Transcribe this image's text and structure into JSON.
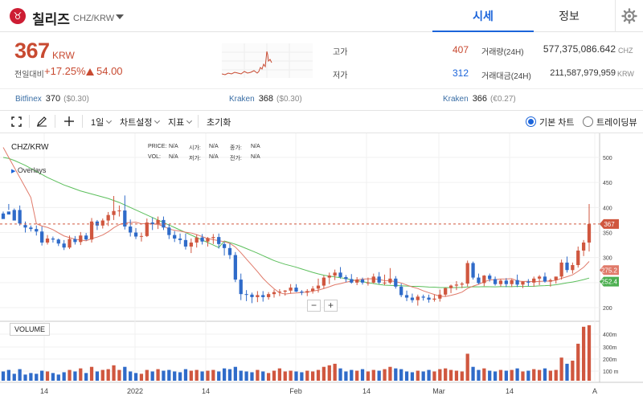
{
  "coin": {
    "logo_glyph": "♉",
    "name": "칠리즈",
    "pair": "CHZ/KRW"
  },
  "tabs": [
    {
      "label": "시세",
      "active": true
    },
    {
      "label": "정보",
      "active": false
    }
  ],
  "price": {
    "value": "367",
    "unit": "KRW",
    "change_label": "전일대비",
    "change_pct": "+17.25%",
    "change_amt": "54.00"
  },
  "stats": {
    "high_label": "고가",
    "high": "407",
    "low_label": "저가",
    "low": "312",
    "volume_label": "거래량(24H)",
    "volume": "577,375,086.642",
    "volume_unit": "CHZ",
    "value_label": "거래대금(24H)",
    "value": "211,587,979,959",
    "value_unit": "KRW"
  },
  "exchanges": [
    {
      "name": "Bitfinex",
      "price": "370",
      "change": "($0.30)"
    },
    {
      "name": "Kraken",
      "price": "368",
      "change": "($0.30)"
    },
    {
      "name": "Kraken",
      "price": "366",
      "change": "(€0.27)"
    }
  ],
  "toolbar": {
    "interval": "1일",
    "chart_settings": "차트설정",
    "indicators": "지표",
    "reset": "초기화",
    "basic_chart": "기본 차트",
    "trading_view": "트레이딩뷰"
  },
  "chart": {
    "symbol": "CHZ/KRW",
    "overlays": "Overlays",
    "volume_label": "VOLUME",
    "legend": {
      "price": "PRICE:",
      "open": "시가:",
      "high": "고가:",
      "close": "종가:",
      "vol": "VOL:",
      "low": "저가:",
      "prev": "전가:",
      "na": "N/A"
    },
    "zoom_out": "−",
    "zoom_in": "+",
    "badge_price": "367",
    "badge_ma1": "275.2",
    "badge_ma2": "252.4"
  },
  "colors": {
    "up": "#d0573f",
    "down": "#2f6bc9",
    "ma_short": "#e07a6a",
    "ma_long": "#5cbf5c",
    "accent": "#1b64da"
  },
  "chart_data": {
    "type": "candlestick",
    "y_ticks": [
      200,
      250,
      300,
      350,
      400,
      450,
      500
    ],
    "ylim": [
      180,
      520
    ],
    "vol_ticks": [
      "100 m",
      "200m",
      "300m",
      "400m"
    ],
    "x_ticks": [
      "14",
      "2022",
      "14",
      "Feb",
      "14",
      "Mar",
      "14",
      "A"
    ],
    "candles": [
      [
        388,
        392,
        385,
        377
      ],
      [
        392,
        407,
        395,
        386
      ],
      [
        395,
        398,
        395,
        374
      ],
      [
        395,
        404,
        364,
        368
      ],
      [
        365,
        372,
        350,
        360
      ],
      [
        360,
        364,
        352,
        357
      ],
      [
        357,
        364,
        344,
        352
      ],
      [
        352,
        362,
        324,
        330
      ],
      [
        330,
        345,
        326,
        338
      ],
      [
        338,
        342,
        330,
        336
      ],
      [
        336,
        338,
        323,
        328
      ],
      [
        328,
        335,
        315,
        320
      ],
      [
        320,
        344,
        317,
        337
      ],
      [
        337,
        343,
        326,
        331
      ],
      [
        331,
        351,
        325,
        344
      ],
      [
        344,
        349,
        334,
        336
      ],
      [
        336,
        379,
        330,
        372
      ],
      [
        372,
        375,
        355,
        364
      ],
      [
        364,
        378,
        358,
        374
      ],
      [
        374,
        391,
        363,
        385
      ],
      [
        385,
        423,
        375,
        393
      ],
      [
        393,
        404,
        382,
        394
      ],
      [
        394,
        424,
        356,
        362
      ],
      [
        362,
        376,
        342,
        350
      ],
      [
        350,
        359,
        337,
        342
      ],
      [
        342,
        350,
        332,
        343
      ],
      [
        343,
        378,
        341,
        370
      ],
      [
        370,
        380,
        355,
        367
      ],
      [
        367,
        382,
        357,
        375
      ],
      [
        375,
        382,
        355,
        360
      ],
      [
        360,
        367,
        337,
        345
      ],
      [
        345,
        353,
        331,
        338
      ],
      [
        338,
        348,
        327,
        335
      ],
      [
        335,
        348,
        316,
        322
      ],
      [
        322,
        338,
        309,
        330
      ],
      [
        330,
        346,
        320,
        340
      ],
      [
        340,
        347,
        326,
        332
      ],
      [
        332,
        341,
        322,
        339
      ],
      [
        339,
        347,
        327,
        341
      ],
      [
        341,
        348,
        318,
        327
      ],
      [
        327,
        331,
        304,
        319
      ],
      [
        319,
        328,
        297,
        305
      ],
      [
        305,
        311,
        251,
        256
      ],
      [
        256,
        268,
        215,
        227
      ],
      [
        227,
        235,
        213,
        226
      ],
      [
        226,
        230,
        209,
        221
      ],
      [
        221,
        233,
        211,
        225
      ],
      [
        225,
        233,
        212,
        221
      ],
      [
        221,
        231,
        216,
        227
      ],
      [
        227,
        236,
        220,
        231
      ],
      [
        231,
        237,
        223,
        232
      ],
      [
        232,
        235,
        224,
        234
      ],
      [
        234,
        247,
        228,
        240
      ],
      [
        240,
        247,
        231,
        232
      ],
      [
        232,
        235,
        225,
        230
      ],
      [
        230,
        237,
        223,
        233
      ],
      [
        233,
        243,
        228,
        238
      ],
      [
        238,
        258,
        230,
        244
      ],
      [
        244,
        264,
        238,
        260
      ],
      [
        260,
        270,
        247,
        264
      ],
      [
        264,
        276,
        255,
        270
      ],
      [
        270,
        281,
        258,
        261
      ],
      [
        261,
        265,
        251,
        257
      ],
      [
        257,
        267,
        248,
        250
      ],
      [
        250,
        261,
        245,
        256
      ],
      [
        256,
        260,
        246,
        250
      ],
      [
        250,
        260,
        244,
        250
      ],
      [
        250,
        268,
        248,
        262
      ],
      [
        262,
        271,
        247,
        250
      ],
      [
        250,
        266,
        245,
        250
      ],
      [
        250,
        279,
        247,
        258
      ],
      [
        258,
        263,
        238,
        242
      ],
      [
        242,
        248,
        221,
        225
      ],
      [
        225,
        234,
        213,
        220
      ],
      [
        220,
        228,
        210,
        215
      ],
      [
        215,
        226,
        204,
        222
      ],
      [
        222,
        226,
        214,
        220
      ],
      [
        220,
        226,
        210,
        216
      ],
      [
        216,
        226,
        212,
        218
      ],
      [
        218,
        236,
        212,
        226
      ],
      [
        226,
        240,
        222,
        239
      ],
      [
        239,
        246,
        229,
        244
      ],
      [
        244,
        253,
        235,
        246
      ],
      [
        246,
        251,
        239,
        248
      ],
      [
        248,
        294,
        242,
        289
      ],
      [
        289,
        292,
        256,
        260
      ],
      [
        260,
        268,
        247,
        249
      ],
      [
        249,
        265,
        243,
        264
      ],
      [
        264,
        268,
        252,
        257
      ],
      [
        257,
        262,
        244,
        247
      ],
      [
        247,
        257,
        242,
        254
      ],
      [
        254,
        259,
        241,
        247
      ],
      [
        247,
        257,
        241,
        255
      ],
      [
        255,
        266,
        241,
        246
      ],
      [
        246,
        253,
        239,
        252
      ],
      [
        252,
        257,
        243,
        250
      ],
      [
        250,
        262,
        242,
        258
      ],
      [
        258,
        265,
        245,
        262
      ],
      [
        262,
        270,
        250,
        252
      ],
      [
        252,
        258,
        242,
        255
      ],
      [
        255,
        262,
        248,
        262
      ],
      [
        262,
        296,
        256,
        290
      ],
      [
        290,
        302,
        270,
        275
      ],
      [
        275,
        290,
        268,
        285
      ],
      [
        285,
        322,
        280,
        314
      ],
      [
        314,
        335,
        303,
        330
      ],
      [
        330,
        407,
        312,
        367
      ]
    ],
    "volumes": [
      12,
      14,
      9,
      15,
      8,
      10,
      9,
      13,
      12,
      10,
      8,
      11,
      14,
      12,
      16,
      10,
      18,
      12,
      14,
      15,
      20,
      14,
      18,
      12,
      10,
      9,
      14,
      12,
      15,
      13,
      14,
      12,
      11,
      15,
      13,
      14,
      12,
      13,
      14,
      12,
      16,
      15,
      18,
      13,
      12,
      11,
      14,
      12,
      10,
      13,
      16,
      12,
      13,
      12,
      11,
      13,
      12,
      14,
      18,
      20,
      22,
      16,
      12,
      14,
      13,
      15,
      12,
      14,
      13,
      15,
      18,
      16,
      15,
      12,
      11,
      13,
      12,
      14,
      12,
      15,
      16,
      14,
      13,
      12,
      35,
      18,
      14,
      16,
      13,
      12,
      14,
      13,
      14,
      16,
      12,
      13,
      15,
      14,
      16,
      13,
      14,
      30,
      22,
      26,
      48,
      70,
      72
    ]
  }
}
